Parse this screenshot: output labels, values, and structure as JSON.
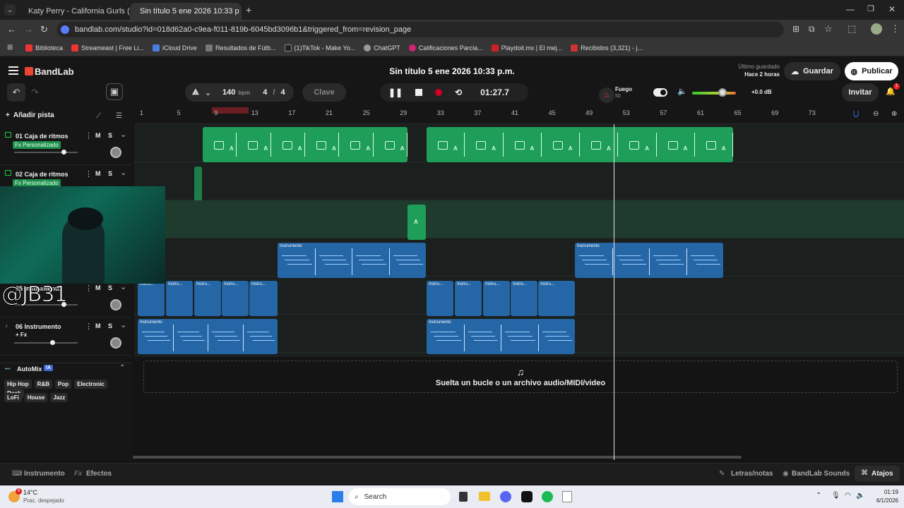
{
  "browser": {
    "tabs": [
      {
        "title": "Katy Perry - California Gurls (Of"
      },
      {
        "title": "Sin título 5 ene 2026 10:33 p"
      }
    ],
    "url": "bandlab.com/studio?id=018d62a0-c9ea-f011-819b-6045bd3096b1&triggered_from=revision_page",
    "bookmarks": [
      {
        "label": "Biblioteca",
        "color": "#e33"
      },
      {
        "label": "Streameast | Free Li...",
        "color": "#e33"
      },
      {
        "label": "iCloud Drive",
        "color": "#4a7de0"
      },
      {
        "label": "Resultados de Fútb...",
        "color": "#777"
      },
      {
        "label": "(1)TikTok - Make Yo...",
        "color": "#222"
      },
      {
        "label": "ChatGPT",
        "color": "#999"
      },
      {
        "label": "Calificaciones Parcia...",
        "color": "#d4236e"
      },
      {
        "label": "Playdoit.mx | El mej...",
        "color": "#c22"
      },
      {
        "label": "Recibidos (3,321) - j...",
        "color": "#c33"
      }
    ]
  },
  "app": {
    "brand": "BandLab",
    "project_title": "Sin título 5 ene 2026 10:33 p.m.",
    "last_saved_label": "Último guardado",
    "last_saved_value": "Hace 2 horas",
    "save_label": "Guardar",
    "publish_label": "Publicar",
    "invite_label": "Invitar",
    "notif_count": "1"
  },
  "transport": {
    "bpm": "140",
    "bpm_unit": "bpm",
    "time_sig_num": "4",
    "time_sig_den": "4",
    "key_label": "Clave",
    "time": "01:27.7",
    "fuego_label": "Fuego",
    "fuego_value": "50",
    "master_db": "+0.0 dB",
    "master_level": 0.7
  },
  "ruler": {
    "markers": [
      "1",
      "5",
      "9",
      "13",
      "17",
      "21",
      "25",
      "29",
      "33",
      "37",
      "41",
      "45",
      "49",
      "53",
      "57",
      "61",
      "65",
      "69",
      "73"
    ]
  },
  "add_track_label": "Añadir pista",
  "tracks": [
    {
      "name": "01  Caja de ritmos",
      "fx": "Fx Personalizado",
      "m": "M",
      "s": "S",
      "volume": 0.78
    },
    {
      "name": "02  Caja de ritmos",
      "fx": "Fx Personalizado",
      "m": "M",
      "s": "S",
      "volume": 0.78
    },
    {
      "name": "05  Instrumento",
      "fx": "",
      "m": "M",
      "s": "S",
      "volume": 0.78
    },
    {
      "name": "06  Instrumento",
      "fx": "+ Fx",
      "m": "M",
      "s": "S",
      "volume": 0.6
    }
  ],
  "clip_labels": {
    "instrument": "Instrumento",
    "short": "Instru..."
  },
  "drop_zone": "Suelta un bucle o un archivo audio/MIDI/video",
  "automix": {
    "label": "AutoMix",
    "badge": "IA",
    "genres": [
      "Hip Hop",
      "R&B",
      "Pop",
      "Electronic",
      "Rock",
      "LoFi",
      "House",
      "Jazz"
    ]
  },
  "watermark": "@JB31",
  "bottom": {
    "instrument": "Instrumento",
    "effects": "Efectos",
    "fx_prefix": "Fx",
    "lyrics": "Letras/notas",
    "sounds": "BandLab Sounds",
    "shortcuts": "Atajos"
  },
  "taskbar": {
    "temp": "14°C",
    "weather": "Prac. despejado",
    "weather_badge": "6",
    "search": "Search",
    "time": "01:19",
    "date": "6/1/2026"
  }
}
